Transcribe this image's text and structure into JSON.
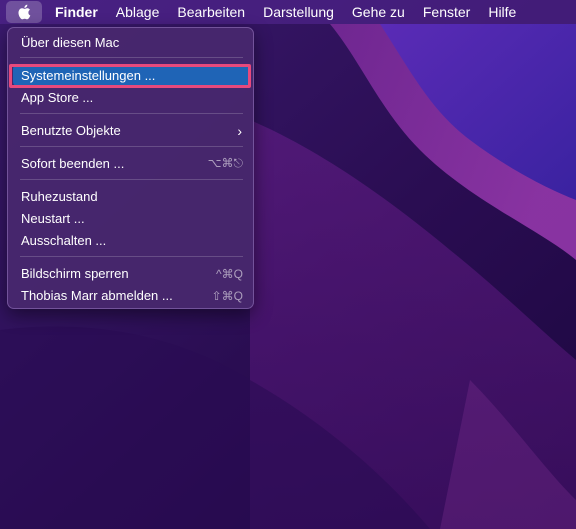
{
  "menubar": {
    "apple_icon": "apple-logo-icon",
    "items": [
      "Finder",
      "Ablage",
      "Bearbeiten",
      "Darstellung",
      "Gehe zu",
      "Fenster",
      "Hilfe"
    ]
  },
  "apple_menu": {
    "items": [
      {
        "label": "Über diesen Mac",
        "shortcut": ""
      },
      {
        "label": "Systemeinstellungen ...",
        "shortcut": ""
      },
      {
        "label": "App Store ...",
        "shortcut": ""
      },
      {
        "label": "Benutzte Objekte",
        "shortcut": "›"
      },
      {
        "label": "Sofort beenden ...",
        "shortcut": "⌥⌘⎋"
      },
      {
        "label": "Ruhezustand",
        "shortcut": ""
      },
      {
        "label": "Neustart ...",
        "shortcut": ""
      },
      {
        "label": "Ausschalten ...",
        "shortcut": ""
      },
      {
        "label": "Bildschirm sperren",
        "shortcut": "^⌘Q"
      },
      {
        "label": "Thobias Marr abmelden ...",
        "shortcut": "⇧⌘Q"
      }
    ],
    "highlighted_item": "Systemeinstellungen ...",
    "annotation_color": "#e8497c",
    "highlight_color": "#1f64b6"
  }
}
